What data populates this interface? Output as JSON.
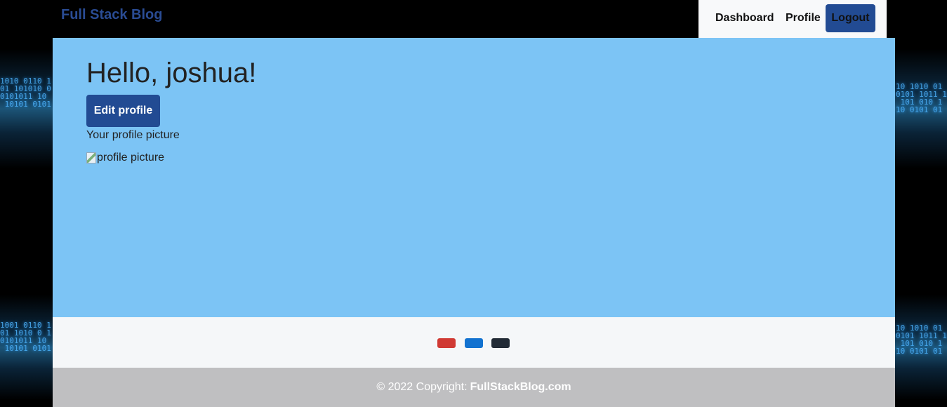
{
  "brand": "Full Stack Blog",
  "nav": {
    "dashboard": "Dashboard",
    "profile": "Profile",
    "logout": "Logout"
  },
  "main": {
    "greeting": "Hello, joshua!",
    "edit_button": "Edit profile",
    "picture_label": "Your profile picture",
    "picture_alt": "profile picture"
  },
  "social": {
    "buttons": [
      {
        "name": "social-button-red",
        "color": "#d03a34"
      },
      {
        "name": "social-button-blue",
        "color": "#1272d0"
      },
      {
        "name": "social-button-dark",
        "color": "#222b36"
      }
    ]
  },
  "footer": {
    "copyright": "© 2022 Copyright:",
    "site": "FullStackBlog.com"
  },
  "colors": {
    "brand": "#2a4c94",
    "primary_button": "#224b93",
    "main_bg": "#7cc4f5",
    "footer_bg": "#bfbfc1"
  }
}
